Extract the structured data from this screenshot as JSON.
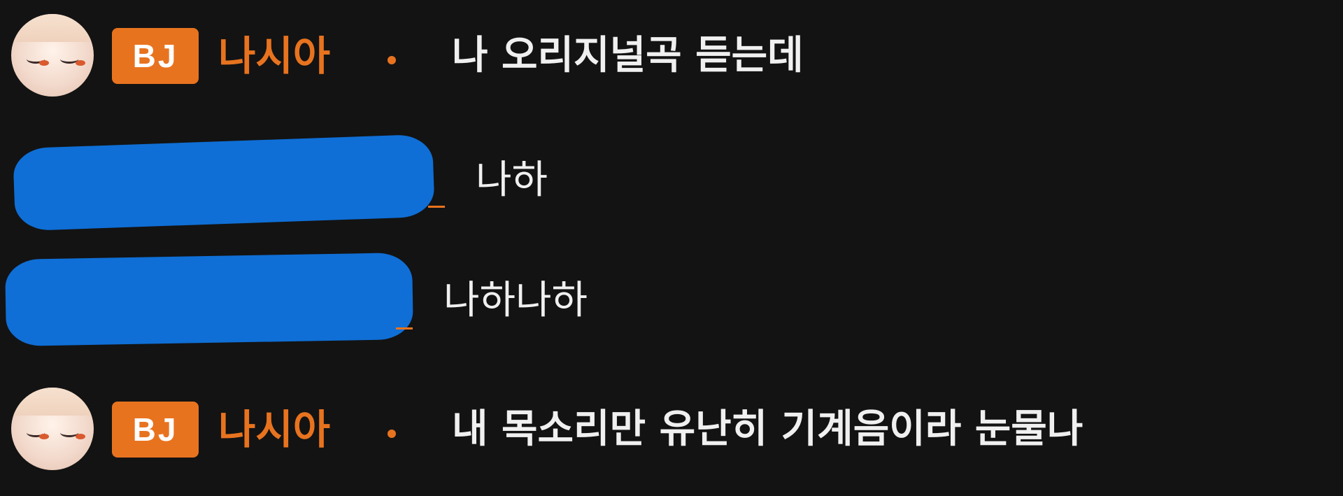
{
  "messages": [
    {
      "badge": "BJ",
      "nickname": "나시아",
      "separator": "•",
      "text": "나 오리지널곡 듣는데",
      "is_streamer": true
    },
    {
      "badge": "",
      "nickname": "",
      "text": "나하",
      "is_streamer": false,
      "redacted": true
    },
    {
      "badge": "",
      "nickname": "",
      "text": "나하나하",
      "is_streamer": false,
      "redacted": true
    },
    {
      "badge": "BJ",
      "nickname": "나시아",
      "separator": "•",
      "text": "내 목소리만 유난히 기계음이라 눈물나",
      "is_streamer": true
    }
  ],
  "colors": {
    "background": "#131313",
    "accent": "#e8731f",
    "text": "#f0f0f0",
    "redaction": "#0f6fd6"
  }
}
